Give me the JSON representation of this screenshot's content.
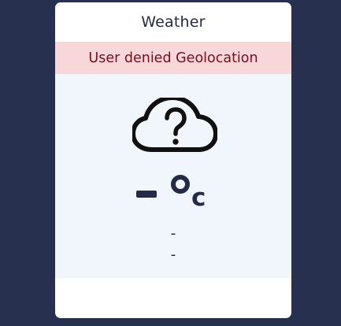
{
  "app": {
    "title": "Weather"
  },
  "alert": {
    "text": "User denied Geolocation"
  },
  "weather": {
    "icon": "cloud-question-icon",
    "temperature": "–",
    "unit": "c",
    "detail_1": "-",
    "detail_2": "-"
  },
  "colors": {
    "page_background": "#283050",
    "card_background": "#ffffff",
    "alert_background": "#f8d7da",
    "alert_text": "#73111b",
    "main_background": "#f1f6fd",
    "icon_color": "#111111",
    "text_color": "#262b45"
  }
}
